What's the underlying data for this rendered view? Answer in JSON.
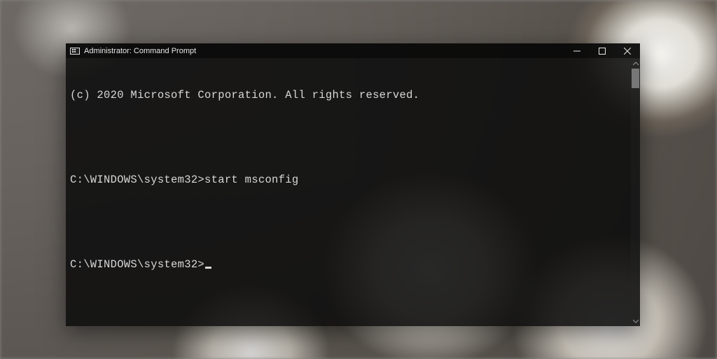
{
  "window": {
    "title": "Administrator: Command Prompt"
  },
  "terminal": {
    "lines": [
      "(c) 2020 Microsoft Corporation. All rights reserved.",
      "",
      "C:\\WINDOWS\\system32>start msconfig",
      "",
      "C:\\WINDOWS\\system32>"
    ]
  },
  "icons": {
    "minimize": "minimize-icon",
    "maximize": "maximize-icon",
    "close": "close-icon",
    "app": "cmd-icon"
  },
  "colors": {
    "terminal_fg": "#d8d8d8",
    "terminal_bg": "rgba(12,12,12,0.88)"
  }
}
